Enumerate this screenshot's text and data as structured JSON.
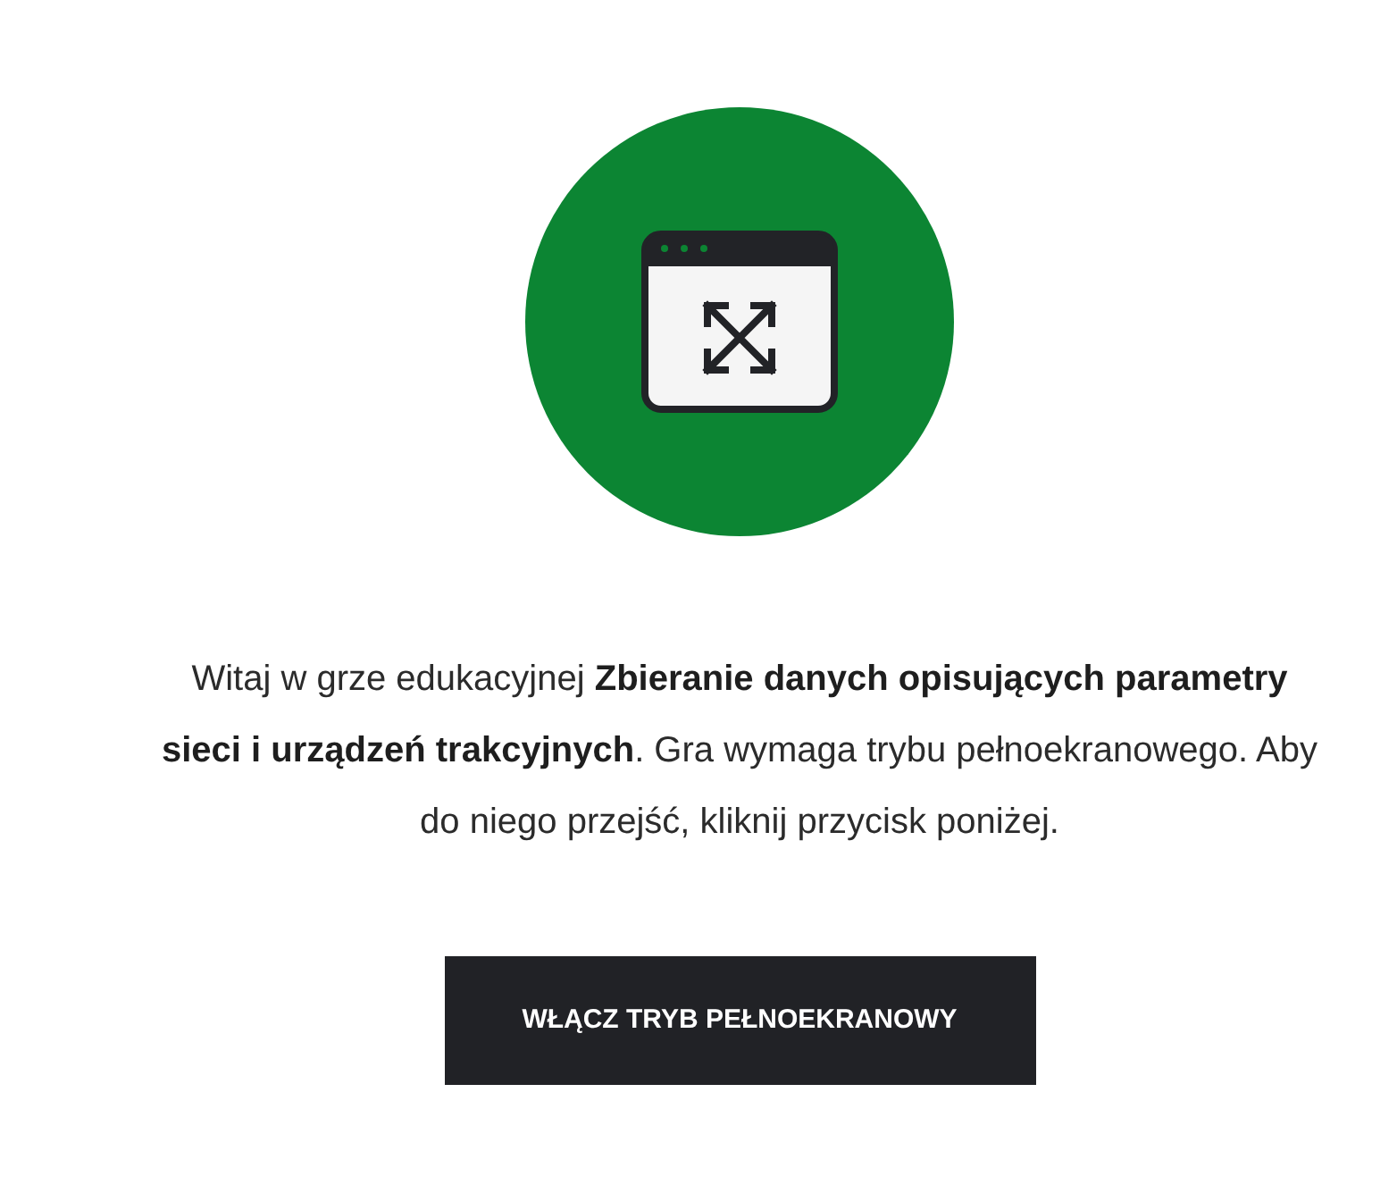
{
  "intro": "Witaj w grze edukacyjnej **Zbieranie danych opisujących parametry sieci i urządzeń trakcyjnych**. Gra wymaga trybu pełnoekranowego. Aby do niego przejść, kliknij przycisk poniżej.",
  "button": "WŁĄCZ TRYB PEŁNOEKRANOWY"
}
